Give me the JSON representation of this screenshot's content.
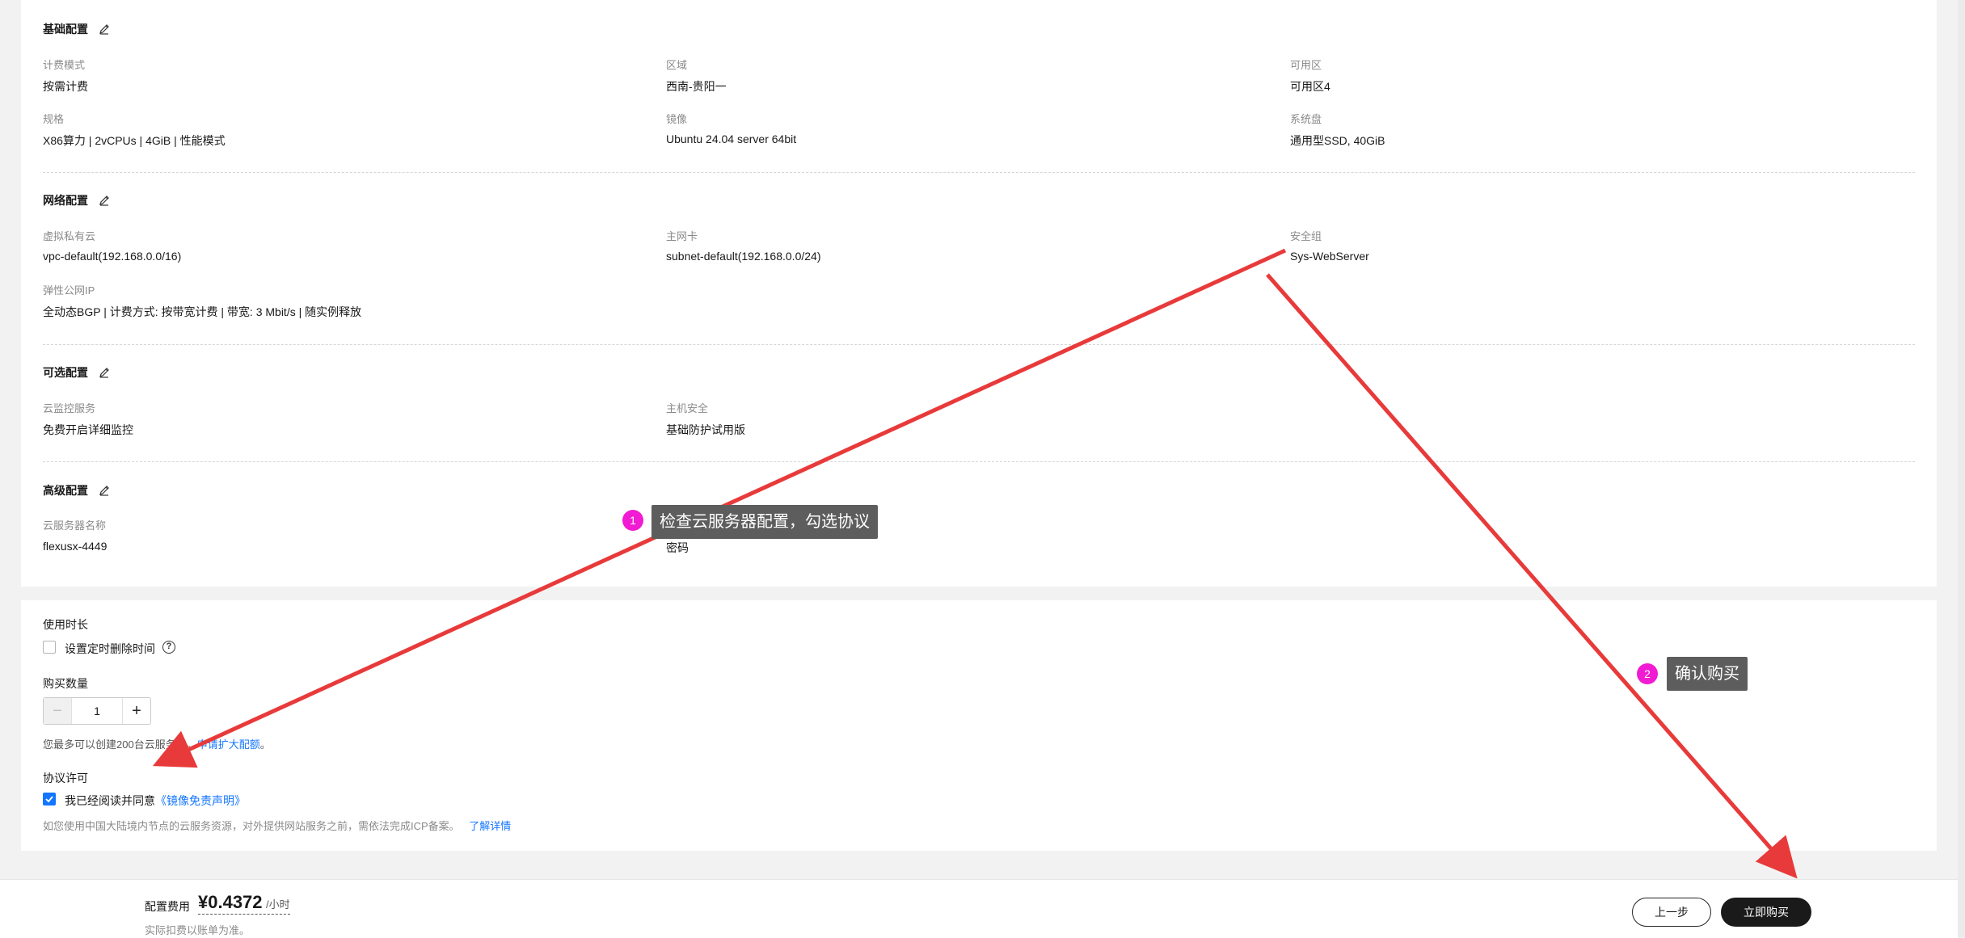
{
  "basic": {
    "title": "基础配置",
    "billing_label": "计费模式",
    "billing_value": "按需计费",
    "region_label": "区域",
    "region_value": "西南-贵阳一",
    "az_label": "可用区",
    "az_value": "可用区4",
    "spec_label": "规格",
    "spec_value": "X86算力 | 2vCPUs | 4GiB | 性能模式",
    "image_label": "镜像",
    "image_value": "Ubuntu 24.04 server 64bit",
    "disk_label": "系统盘",
    "disk_value": "通用型SSD, 40GiB"
  },
  "network": {
    "title": "网络配置",
    "vpc_label": "虚拟私有云",
    "vpc_value": "vpc-default(192.168.0.0/16)",
    "nic_label": "主网卡",
    "nic_value": "subnet-default(192.168.0.0/24)",
    "sg_label": "安全组",
    "sg_value": "Sys-WebServer",
    "eip_label": "弹性公网IP",
    "eip_value": "全动态BGP | 计费方式: 按带宽计费 | 带宽: 3 Mbit/s | 随实例释放"
  },
  "optional": {
    "title": "可选配置",
    "monitor_label": "云监控服务",
    "monitor_value": "免费开启详细监控",
    "hss_label": "主机安全",
    "hss_value": "基础防护试用版"
  },
  "advanced": {
    "title": "高级配置",
    "name_label": "云服务器名称",
    "name_value": "flexusx-4449",
    "password_value": "密码"
  },
  "purchase": {
    "duration_title": "使用时长",
    "timed_delete_label": "设置定时删除时间",
    "quantity_title": "购买数量",
    "quantity_minus": "−",
    "quantity_value": "1",
    "quantity_plus": "+",
    "limit_text": "您最多可以创建200台云服务器。",
    "limit_link": "申请扩大配额",
    "limit_suffix": "。",
    "agreement_title": "协议许可",
    "agree_text": "我已经阅读并同意",
    "agree_link": "《镜像免责声明》",
    "icp_text": "如您使用中国大陆境内节点的云服务资源，对外提供网站服务之前，需依法完成ICP备案。",
    "icp_link": "了解详情"
  },
  "footer": {
    "fee_label": "配置费用",
    "fee_price": "¥0.4372",
    "fee_unit": "/小时",
    "fee_note": "实际扣费以账单为准。",
    "prev_button": "上一步",
    "buy_button": "立即购买"
  },
  "annotations": [
    {
      "number": "1",
      "text": "检查云服务器配置，勾选协议"
    },
    {
      "number": "2",
      "text": "确认购买"
    }
  ],
  "colors": {
    "link": "#1476ff",
    "badge": "#f01bd3",
    "arrow": "#e83a3a",
    "callout_bg": "#5d5d5d"
  }
}
